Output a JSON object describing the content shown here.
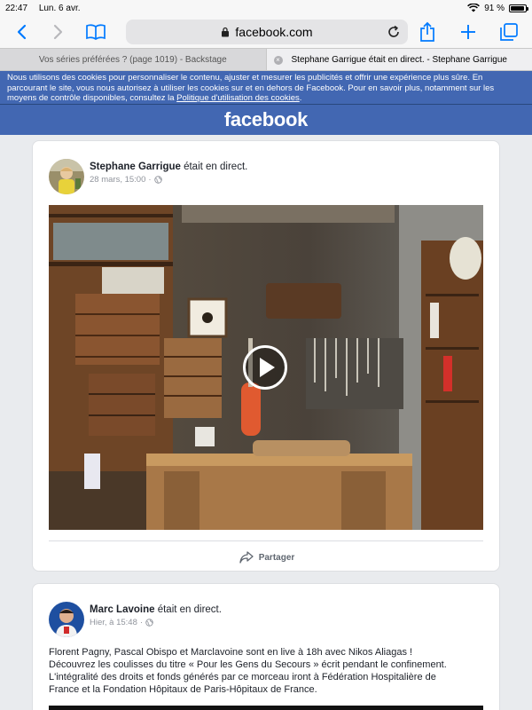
{
  "status_bar": {
    "time": "22:47",
    "date": "Lun. 6 avr.",
    "battery_text": "91 %",
    "battery_level": 0.91
  },
  "browser": {
    "url": "facebook.com",
    "tabs": [
      {
        "label": "Vos séries préférées ? (page 1019) - Backstage",
        "active": false
      },
      {
        "label": "Stephane Garrigue était en direct. - Stephane Garrigue",
        "active": true
      }
    ]
  },
  "cookie_banner": {
    "text": "Nous utilisons des cookies pour personnaliser le contenu, ajuster et mesurer les publicités et offrir une expérience plus sûre. En parcourant le site, vous nous autorisez à utiliser les cookies sur et en dehors de Facebook. Pour en savoir plus, notamment sur les moyens de contrôle disponibles, consultez la ",
    "link": "Politique d'utilisation des cookies",
    "end": "."
  },
  "header": {
    "logo": "facebook"
  },
  "posts": [
    {
      "author": "Stephane Garrigue",
      "action": "était en direct.",
      "date": "28 mars, 15:00",
      "share_label": "Partager"
    },
    {
      "author": "Marc Lavoine",
      "action": "était en direct.",
      "date": "Hier, à 15:48",
      "body": [
        "Florent Pagny, Pascal Obispo et Marclavoine sont en live à 18h avec Nikos Aliagas !",
        "Découvrez les coulisses du titre « Pour les Gens du Secours » écrit pendant le confinement.",
        "L'intégralité des droits et fonds générés par ce morceau iront à Fédération Hospitalière de",
        "France et la Fondation Hôpitaux de Paris-Hôpitaux de France."
      ]
    }
  ],
  "colors": {
    "facebook_blue": "#4267b2",
    "ios_blue": "#007aff",
    "feed_bg": "#e9ebee"
  }
}
